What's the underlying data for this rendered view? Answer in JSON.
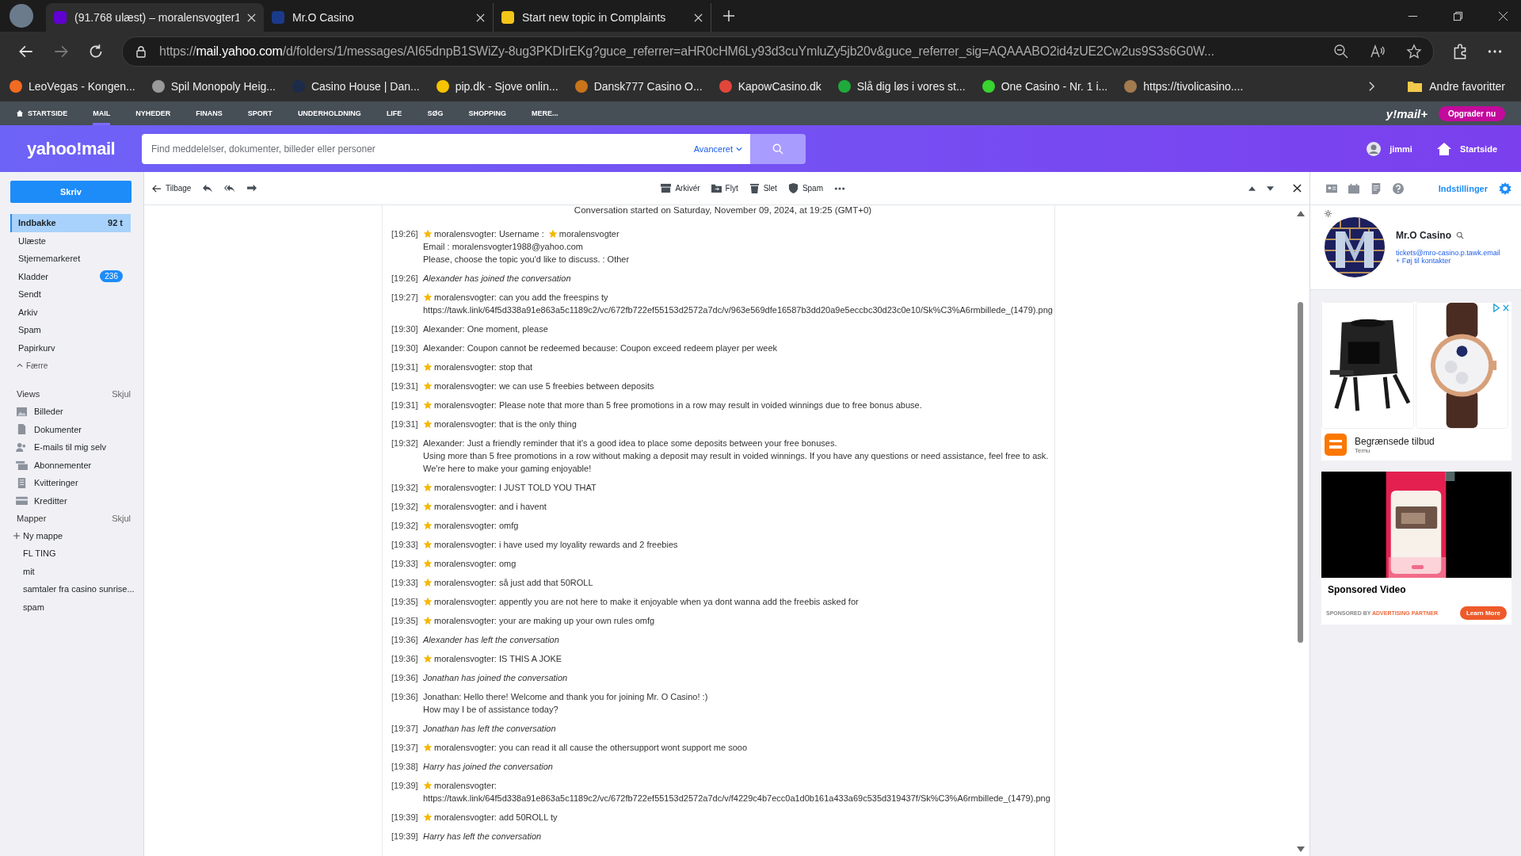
{
  "browser": {
    "tabs": [
      {
        "title": "(91.768 ulæst) – moralensvogter1",
        "selected": true,
        "color": "#6001d2"
      },
      {
        "title": "Mr.O Casino",
        "selected": false,
        "color": "#1b3a8a"
      },
      {
        "title": "Start new topic in Complaints",
        "selected": false,
        "color": "#f5c518"
      }
    ],
    "address": {
      "scheme": "https://",
      "host": "mail.yahoo.com",
      "rest": "/d/folders/1/messages/AI65dnpB1SWiZy-8ug3PKDIrEKg?guce_referrer=aHR0cHM6Ly93d3cuYmluZy5jb20v&guce_referrer_sig=AQAAABO2id4zUE2Cw2us9S3s6G0W..."
    },
    "bookmarks": [
      {
        "label": "LeoVegas - Kongen...",
        "color": "#f26b21"
      },
      {
        "label": "Spil Monopoly Heig...",
        "color": "#9a9a9a"
      },
      {
        "label": "Casino House | Dan...",
        "color": "#1c2b4a"
      },
      {
        "label": "pip.dk - Sjove onlin...",
        "color": "#f5c400"
      },
      {
        "label": "Dansk777 Casino O...",
        "color": "#c8741a"
      },
      {
        "label": "KapowCasino.dk",
        "color": "#e2463a"
      },
      {
        "label": "Slå dig løs i vores st...",
        "color": "#1faa3b"
      },
      {
        "label": "One Casino - Nr. 1 i...",
        "color": "#38d430"
      },
      {
        "label": "https://tivolicasino....",
        "color": "#a37b4f"
      }
    ],
    "favorites_folder": "Andre favoritter"
  },
  "yahoo_nav": {
    "items": [
      {
        "label": "STARTSIDE",
        "selected": false
      },
      {
        "label": "MAIL",
        "selected": true
      },
      {
        "label": "NYHEDER",
        "selected": false
      },
      {
        "label": "FINANS",
        "selected": false
      },
      {
        "label": "SPORT",
        "selected": false
      },
      {
        "label": "UNDERHOLDNING",
        "selected": false
      },
      {
        "label": "LIFE",
        "selected": false
      },
      {
        "label": "SØG",
        "selected": false
      },
      {
        "label": "SHOPPING",
        "selected": false
      },
      {
        "label": "MERE...",
        "selected": false
      }
    ],
    "brand": "y!mail+",
    "upgrade": "Opgrader nu"
  },
  "header": {
    "logo": "yahoo!mail",
    "search": {
      "placeholder": "Find meddelelser, dokumenter, billeder eller personer"
    },
    "advanced": "Avanceret",
    "user": "jimmi",
    "home": "Startside"
  },
  "sidebar": {
    "compose": "Skriv",
    "folders": [
      {
        "label": "Indbakke",
        "selected": true,
        "count": "92 t"
      },
      {
        "label": "Ulæste",
        "selected": false
      },
      {
        "label": "Stjernemarkeret",
        "selected": false
      },
      {
        "label": "Kladder",
        "selected": false,
        "badge": "236"
      },
      {
        "label": "Sendt",
        "selected": false
      },
      {
        "label": "Arkiv",
        "selected": false
      },
      {
        "label": "Spam",
        "selected": false
      },
      {
        "label": "Papirkurv",
        "selected": false
      }
    ],
    "less": "Færre",
    "views": {
      "title": "Views",
      "hide": "Skjul",
      "items": [
        "Billeder",
        "Dokumenter",
        "E-mails til mig selv",
        "Abonnementer",
        "Kvitteringer",
        "Kreditter"
      ]
    },
    "mapper": {
      "title": "Mapper",
      "hide": "Skjul",
      "new": "Ny mappe",
      "items": [
        "FL TING",
        "mit",
        "samtaler fra casino sunrise...",
        "spam"
      ]
    }
  },
  "toolbar": {
    "back": "Tilbage",
    "actions": [
      "Arkivér",
      "Flyt",
      "Slet",
      "Spam"
    ]
  },
  "conversation": {
    "started": "Conversation started on Saturday, November 09, 2024, at 19:25 (GMT+0)",
    "messages": [
      {
        "time": "[19:26]",
        "kind": "user",
        "lines": [
          "moralensvogter: Username :",
          "Email : moralensvogter1988@yahoo.com",
          "Please, choose the topic you'd like to discuss. : Other"
        ],
        "starred_name": "moralensvogter"
      },
      {
        "time": "[19:26]",
        "kind": "event",
        "lines": [
          "Alexander has joined the conversation"
        ]
      },
      {
        "time": "[19:27]",
        "kind": "user",
        "lines": [
          "moralensvogter: can you add the freespins ty",
          "https://tawk.link/64f5d338a91e863a5c1189c2/vc/672fb722ef55153d2572a7dc/v/963e569dfe16587b3dd20a9e5eccbc30d23c0e10/Sk%C3%A6rmbillede_(1479).png"
        ]
      },
      {
        "time": "[19:30]",
        "kind": "agent",
        "lines": [
          "Alexander: One moment, please"
        ]
      },
      {
        "time": "[19:30]",
        "kind": "agent",
        "lines": [
          "Alexander: Coupon cannot be redeemed because: Coupon exceed redeem player per week"
        ]
      },
      {
        "time": "[19:31]",
        "kind": "user",
        "lines": [
          "moralensvogter: stop that"
        ]
      },
      {
        "time": "[19:31]",
        "kind": "user",
        "lines": [
          "moralensvogter: we can use 5 freebies between deposits"
        ]
      },
      {
        "time": "[19:31]",
        "kind": "user",
        "lines": [
          "moralensvogter: Please note that more than 5 free promotions in a row may result in voided winnings due to free bonus abuse."
        ]
      },
      {
        "time": "[19:31]",
        "kind": "user",
        "lines": [
          "moralensvogter: that is the only thing"
        ]
      },
      {
        "time": "[19:32]",
        "kind": "agent",
        "lines": [
          "Alexander: Just a friendly reminder that it's a good idea to place some deposits between your free bonuses.",
          "Using more than 5 free promotions in a row without making a deposit may result in voided winnings. If you have any questions or need assistance, feel free to ask.",
          "We're here to make your gaming enjoyable!"
        ]
      },
      {
        "time": "[19:32]",
        "kind": "user",
        "lines": [
          "moralensvogter: I JUST TOLD YOU THAT"
        ]
      },
      {
        "time": "[19:32]",
        "kind": "user",
        "lines": [
          "moralensvogter: and i havent"
        ]
      },
      {
        "time": "[19:32]",
        "kind": "user",
        "lines": [
          "moralensvogter: omfg"
        ]
      },
      {
        "time": "[19:33]",
        "kind": "user",
        "lines": [
          "moralensvogter: i have used my loyality rewards and 2 freebies"
        ]
      },
      {
        "time": "[19:33]",
        "kind": "user",
        "lines": [
          "moralensvogter: omg"
        ]
      },
      {
        "time": "[19:33]",
        "kind": "user",
        "lines": [
          "moralensvogter: så just add that 50ROLL"
        ]
      },
      {
        "time": "[19:35]",
        "kind": "user",
        "lines": [
          "moralensvogter: appently you are not here to make it enjoyable when ya dont wanna add the freebis asked for"
        ]
      },
      {
        "time": "[19:35]",
        "kind": "user",
        "lines": [
          "moralensvogter: your are making up your own rules omfg"
        ]
      },
      {
        "time": "[19:36]",
        "kind": "event",
        "lines": [
          "Alexander has left the conversation"
        ]
      },
      {
        "time": "[19:36]",
        "kind": "user",
        "lines": [
          "moralensvogter: IS THIS A JOKE"
        ]
      },
      {
        "time": "[19:36]",
        "kind": "event",
        "lines": [
          "Jonathan has joined the conversation"
        ]
      },
      {
        "time": "[19:36]",
        "kind": "agent",
        "lines": [
          "Jonathan: Hello there! Welcome and thank you for joining Mr. O Casino! :)",
          "How may I be of assistance today?"
        ]
      },
      {
        "time": "[19:37]",
        "kind": "event",
        "lines": [
          "Jonathan has left the conversation"
        ]
      },
      {
        "time": "[19:37]",
        "kind": "user",
        "lines": [
          "moralensvogter: you can read it all cause the othersupport wont support me sooo"
        ]
      },
      {
        "time": "[19:38]",
        "kind": "event",
        "lines": [
          "Harry has joined the conversation"
        ]
      },
      {
        "time": "[19:39]",
        "kind": "user",
        "lines": [
          "moralensvogter:",
          "https://tawk.link/64f5d338a91e863a5c1189c2/vc/672fb722ef55153d2572a7dc/v/f4229c4b7ecc0a1d0b161a433a69c535d319437f/Sk%C3%A6rmbillede_(1479).png"
        ]
      },
      {
        "time": "[19:39]",
        "kind": "user",
        "lines": [
          "moralensvogter: add 50ROLL ty"
        ]
      },
      {
        "time": "[19:39]",
        "kind": "event",
        "lines": [
          "Harry has left the conversation"
        ]
      }
    ]
  },
  "right_panel": {
    "settings": "Indstillinger",
    "contact": {
      "name": "Mr.O Casino",
      "email": "tickets@mro-casino.p.tawk.email",
      "add": "+ Føj til kontakter"
    },
    "ad": {
      "title": "Begrænsede tilbud",
      "advertiser": "Temu"
    },
    "video_ad": {
      "title": "Sponsored Video",
      "by": "SPONSORED BY",
      "partner": "ADVERTISING PARTNER",
      "cta": "Learn More"
    }
  }
}
